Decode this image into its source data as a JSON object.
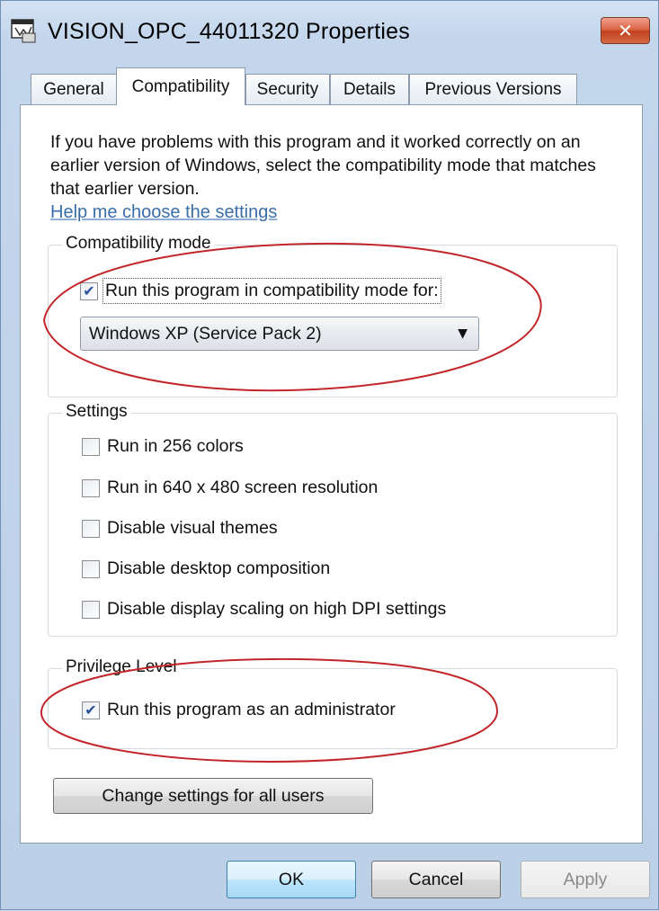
{
  "window": {
    "title": "VISION_OPC_44011320 Properties",
    "close_glyph": "✕"
  },
  "tabs": [
    {
      "label": "General",
      "active": false
    },
    {
      "label": "Compatibility",
      "active": true
    },
    {
      "label": "Security",
      "active": false
    },
    {
      "label": "Details",
      "active": false
    },
    {
      "label": "Previous Versions",
      "active": false
    }
  ],
  "compat": {
    "intro_text": "If you have problems with this program and it worked correctly on an earlier version of Windows, select the compatibility mode that matches that earlier version.",
    "help_link": "Help me choose the settings",
    "mode_group": {
      "legend": "Compatibility mode",
      "run_in_compat_label": "Run this program in compatibility mode for:",
      "run_in_compat_checked": true,
      "os_selected": "Windows XP (Service Pack 2)"
    },
    "settings_group": {
      "legend": "Settings",
      "items": [
        {
          "label": "Run in 256 colors",
          "checked": false
        },
        {
          "label": "Run in 640 x 480 screen resolution",
          "checked": false
        },
        {
          "label": "Disable visual themes",
          "checked": false
        },
        {
          "label": "Disable desktop composition",
          "checked": false
        },
        {
          "label": "Disable display scaling on high DPI settings",
          "checked": false
        }
      ]
    },
    "privilege_group": {
      "legend": "Privilege Level",
      "run_as_admin_label": "Run this program as an administrator",
      "run_as_admin_checked": true
    },
    "change_all_users_label": "Change settings for all users"
  },
  "footer": {
    "ok_label": "OK",
    "cancel_label": "Cancel",
    "apply_label": "Apply",
    "apply_enabled": false
  },
  "icons": {
    "app": "application-icon",
    "close": "close-icon",
    "dropdown": "chevron-down-icon",
    "check": "checkmark-icon"
  },
  "colors": {
    "link": "#3a6ea8",
    "annotation_ellipse": "#c2262a",
    "close_button": "#d9603f"
  }
}
